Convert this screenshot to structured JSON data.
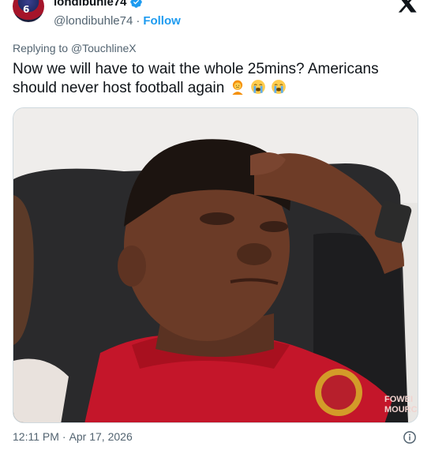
{
  "user": {
    "display_name": "londibuhle74",
    "handle": "@londibuhle74",
    "separator": "·",
    "follow_label": "Follow",
    "avatar_number": "6"
  },
  "reply": {
    "prefix": "Replying to",
    "mention": "@TouchlineX"
  },
  "tweet": {
    "text": "Now we will have to wait the whole 25mins? Americans should never host football again",
    "emojis": [
      "person-frowning-emoji",
      "loudly-crying-face-emoji",
      "loudly-crying-face-emoji"
    ]
  },
  "media": {
    "badge_text_1": "FOWEI",
    "badge_text_2": "MOURC"
  },
  "footer": {
    "time": "12:11 PM",
    "separator": "·",
    "date": "Apr 17, 2026"
  },
  "colors": {
    "accent": "#1d9bf0",
    "secondary_text": "#536471",
    "primary_text": "#0f1419",
    "shirt_red": "#c4162a"
  },
  "icons": [
    "verified-badge-icon",
    "close-icon",
    "info-icon"
  ]
}
